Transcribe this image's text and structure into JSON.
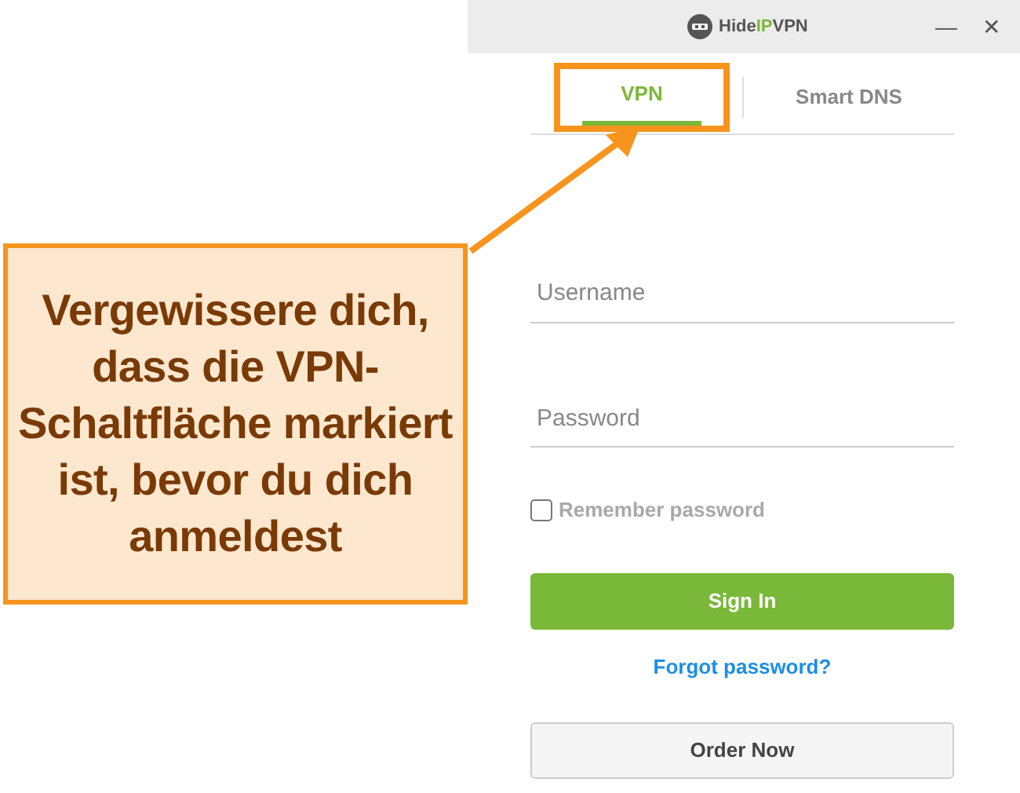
{
  "window": {
    "logo": [
      {
        "text": "Hide",
        "color": "#555555"
      },
      {
        "text": "IP",
        "color": "#7ab83a"
      },
      {
        "text": "VPN",
        "color": "#555555"
      }
    ],
    "minimize": "—",
    "close": "✕"
  },
  "tabs": [
    {
      "label": "VPN",
      "selected": true
    },
    {
      "label": "Smart DNS",
      "selected": false
    }
  ],
  "fields": [
    {
      "placeholder": "Username"
    },
    {
      "placeholder": "Password"
    }
  ],
  "remember": {
    "label": "Remember password",
    "checked": false
  },
  "sign_in": "Sign In",
  "forgot": "Forgot password?",
  "order": "Order Now",
  "annotation": {
    "text": "Vergewissere dich, dass die VPN-Schaltfläche markiert ist, bevor du dich anmeldest"
  }
}
